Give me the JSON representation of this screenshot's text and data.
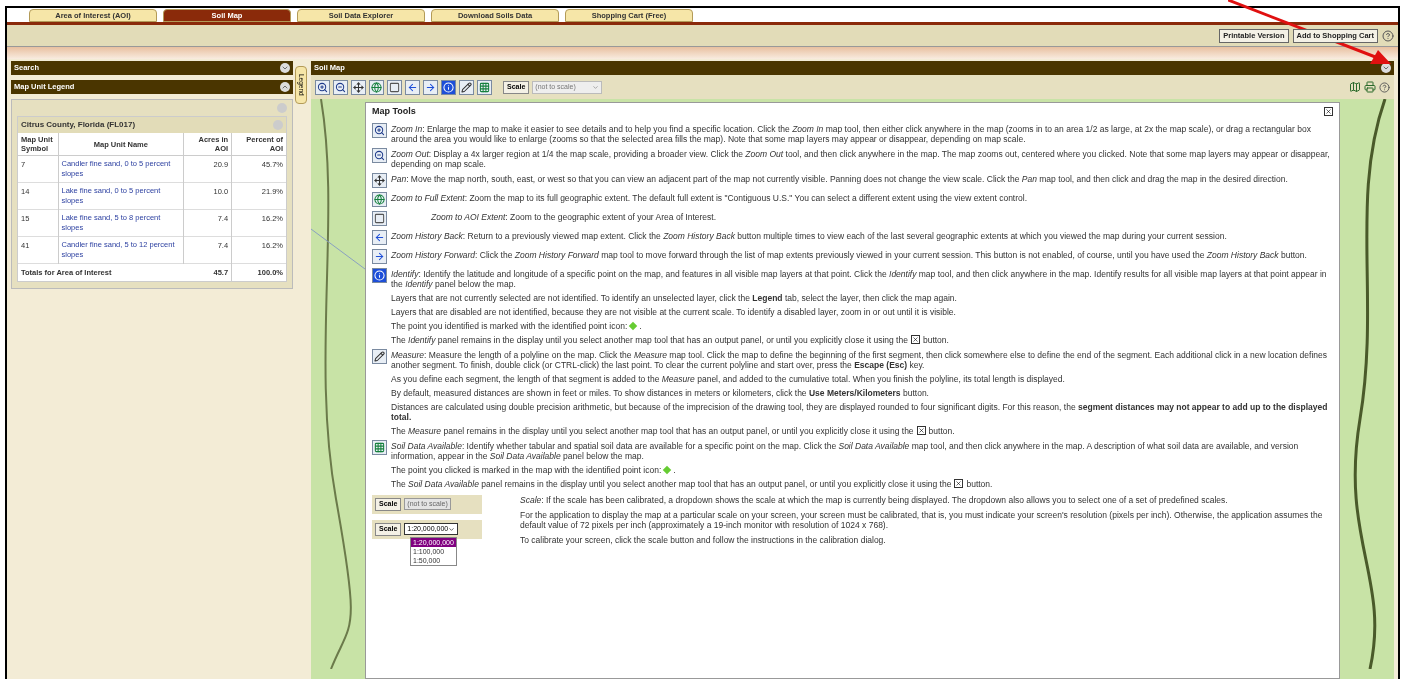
{
  "tabs": [
    {
      "label": "Area of Interest (AOI)",
      "selected": false
    },
    {
      "label": "Soil Map",
      "selected": true
    },
    {
      "label": "Soil Data Explorer",
      "selected": false
    },
    {
      "label": "Download Soils Data",
      "selected": false
    },
    {
      "label": "Shopping Cart (Free)",
      "selected": false
    }
  ],
  "header_buttons": [
    "Printable Version",
    "Add to Shopping Cart"
  ],
  "left_panels": [
    {
      "title": "Search",
      "expanded": false
    },
    {
      "title": "Map Unit Legend",
      "expanded": true
    }
  ],
  "legend_tab": "Legend",
  "legend": {
    "title": "Citrus County, Florida (FL017)",
    "columns": [
      "Map Unit Symbol",
      "Map Unit Name",
      "Acres in AOI",
      "Percent of AOI"
    ],
    "rows": [
      {
        "symbol": "7",
        "name": "Candler fine sand, 0 to 5 percent slopes",
        "acres": "20.9",
        "percent": "45.7%"
      },
      {
        "symbol": "14",
        "name": "Lake fine sand, 0 to 5 percent slopes",
        "acres": "10.0",
        "percent": "21.9%"
      },
      {
        "symbol": "15",
        "name": "Lake fine sand, 5 to 8 percent slopes",
        "acres": "7.4",
        "percent": "16.2%"
      },
      {
        "symbol": "41",
        "name": "Candler fine sand, 5 to 12 percent slopes",
        "acres": "7.4",
        "percent": "16.2%"
      }
    ],
    "total": {
      "label": "Totals for Area of Interest",
      "acres": "45.7",
      "percent": "100.0%"
    }
  },
  "map": {
    "title": "Soil Map",
    "scale_button": "Scale",
    "scale_value": "(not to scale)",
    "tools": [
      {
        "kind": "zoom_in"
      },
      {
        "kind": "zoom_out"
      },
      {
        "kind": "pan"
      },
      {
        "kind": "full_extent"
      },
      {
        "kind": "aoi_extent"
      },
      {
        "kind": "back"
      },
      {
        "kind": "forward"
      },
      {
        "kind": "identify"
      },
      {
        "kind": "measure"
      },
      {
        "kind": "soil_data"
      }
    ]
  },
  "help": {
    "title": "Map Tools",
    "items": [
      {
        "kind": "zoom_in",
        "paragraphs": [
          {
            "kind": "text",
            "text": "*Zoom In*: Enlarge the map to make it easier to see details and to help you find a specific location. Click the *Zoom In* map tool, then either click anywhere in the map (zooms in to an area 1/2 as large, at 2x the map scale), or drag a rectangular box around the area you would like to enlarge (zooms so that the selected area fills the map). Note that some map layers may appear or disappear, depending on map scale."
          }
        ]
      },
      {
        "kind": "zoom_out",
        "paragraphs": [
          {
            "kind": "text",
            "text": "*Zoom Out*: Display a 4x larger region at 1/4 the map scale, providing a broader view. Click the *Zoom Out* tool, and then click anywhere in the map. The map zooms out, centered where you clicked. Note that some map layers may appear or disappear, depending on map scale."
          }
        ]
      },
      {
        "kind": "pan",
        "paragraphs": [
          {
            "kind": "text",
            "text": "*Pan*: Move the map north, south, east, or west so that you can view an adjacent part of the map not currently visible. Panning does not change the view scale. Click the *Pan* map tool, and then click and drag the map in the desired direction."
          }
        ]
      },
      {
        "kind": "full_extent",
        "paragraphs": [
          {
            "kind": "text",
            "text": "*Zoom to Full Extent*: Zoom the map to its full geographic extent. The default full extent is \"Contiguous U.S.\" You can select a different extent using the view extent control."
          }
        ]
      },
      {
        "kind": "aoi_extent",
        "paragraphs": [
          {
            "kind": "text",
            "text": "*Zoom to AOI Extent*: Zoom to the geographic extent of your Area of Interest."
          }
        ]
      },
      {
        "kind": "back",
        "paragraphs": [
          {
            "kind": "text",
            "text": "*Zoom History Back*: Return to a previously viewed map extent. Click the *Zoom History Back* button multiple times to view each of the last several geographic extents at which you viewed the map during your current session."
          }
        ]
      },
      {
        "kind": "forward",
        "paragraphs": [
          {
            "kind": "text",
            "text": "*Zoom History Forward*: Click the *Zoom History Forward* map tool to move forward through the list of map extents previously viewed in your current session. This button is not enabled, of course, until you have used the *Zoom History Back* button."
          }
        ]
      },
      {
        "kind": "identify",
        "paragraphs": [
          {
            "kind": "text",
            "text": "*Identify*: Identify the latitude and longitude of a specific point on the map, and features in all visible map layers at that point. Click the *Identify* map tool, and then click anywhere in the map. Identify results for all visible map layers at that point appear in the *Identify* panel below the map."
          },
          {
            "kind": "text",
            "text": "Layers that are not currently selected are not identified. To identify an unselected layer, click the **Legend** tab, select the layer, then click the map again."
          },
          {
            "kind": "text",
            "text": "Layers that are disabled are not identified, because they are not visible at the current scale. To identify a disabled layer, zoom in or out until it is visible."
          },
          {
            "kind": "point_icon",
            "before": "The point you identified is marked with the identified point icon:",
            "after": "."
          },
          {
            "kind": "close_icon",
            "before": "The *Identify* panel remains in the display until you select another map tool that has an output panel, or until you explicitly close it using the",
            "after": "button."
          }
        ]
      },
      {
        "kind": "measure",
        "paragraphs": [
          {
            "kind": "text",
            "text": "*Measure*: Measure the length of a polyline on the map. Click the *Measure* map tool. Click the map to define the beginning of the first segment, then click somewhere else to define the end of the segment. Each additional click in a new location defines another segment. To finish, double click (or CTRL-click) the last point. To clear the current polyline and start over, press the **Escape (Esc)** key."
          },
          {
            "kind": "text",
            "text": "As you define each segment, the length of that segment is added to the *Measure* panel, and added to the cumulative total. When you finish the polyline, its total length is displayed."
          },
          {
            "kind": "text",
            "text": "By default, measured distances are shown in feet or miles. To show distances in meters or kilometers, click the **Use Meters/Kilometers** button."
          },
          {
            "kind": "text",
            "text": "Distances are calculated using double precision arithmetic, but because of the imprecision of the drawing tool, they are displayed rounded to four significant digits. For this reason, the **segment distances may not appear to add up to the displayed total.**"
          },
          {
            "kind": "close_icon",
            "before": "The *Measure* panel remains in the display until you select another map tool that has an output panel, or until you explicitly close it using the",
            "after": "button."
          }
        ]
      },
      {
        "kind": "soil_data",
        "paragraphs": [
          {
            "kind": "text",
            "text": "*Soil Data Available*: Identify whether tabular and spatial soil data are available for a specific point on the map. Click the *Soil Data Available* map tool, and then click anywhere in the map. A description of what soil data are available, and version information, appear in the *Soil Data Available* panel below the map."
          },
          {
            "kind": "point_icon",
            "before": "The point you clicked is marked in the map with the identified point icon:",
            "after": "."
          },
          {
            "kind": "close_icon",
            "before": "The *Soil Data Available* panel remains in the display until you select another map tool that has an output panel, or until you explicitly close it using the",
            "after": "button."
          }
        ]
      }
    ],
    "scale_demo": [
      {
        "kind": "disabled",
        "button": "Scale",
        "value": "(not to scale)"
      },
      {
        "kind": "dropdown",
        "button": "Scale",
        "value": "1:20,000,000",
        "options": [
          {
            "label": "1:20,000,000",
            "selected": true
          },
          {
            "label": "1:100,000",
            "selected": false
          },
          {
            "label": "1:50,000",
            "selected": false
          }
        ]
      }
    ],
    "scale_text": [
      "*Scale*: If the scale has been calibrated, a dropdown shows the scale at which the map is currently being displayed. The dropdown also allows you to select one of a set of predefined scales.",
      "For the application to display the map at a particular scale on your screen, your screen must be calibrated, that is, you must indicate your screen's resolution (pixels per inch). Otherwise, the application assumes the default value of 72 pixels per inch (approximately a 19-inch monitor with resolution of 1024 x 768).",
      "To calibrate your screen, click the scale button and follow the instructions in the calibration dialog."
    ]
  }
}
